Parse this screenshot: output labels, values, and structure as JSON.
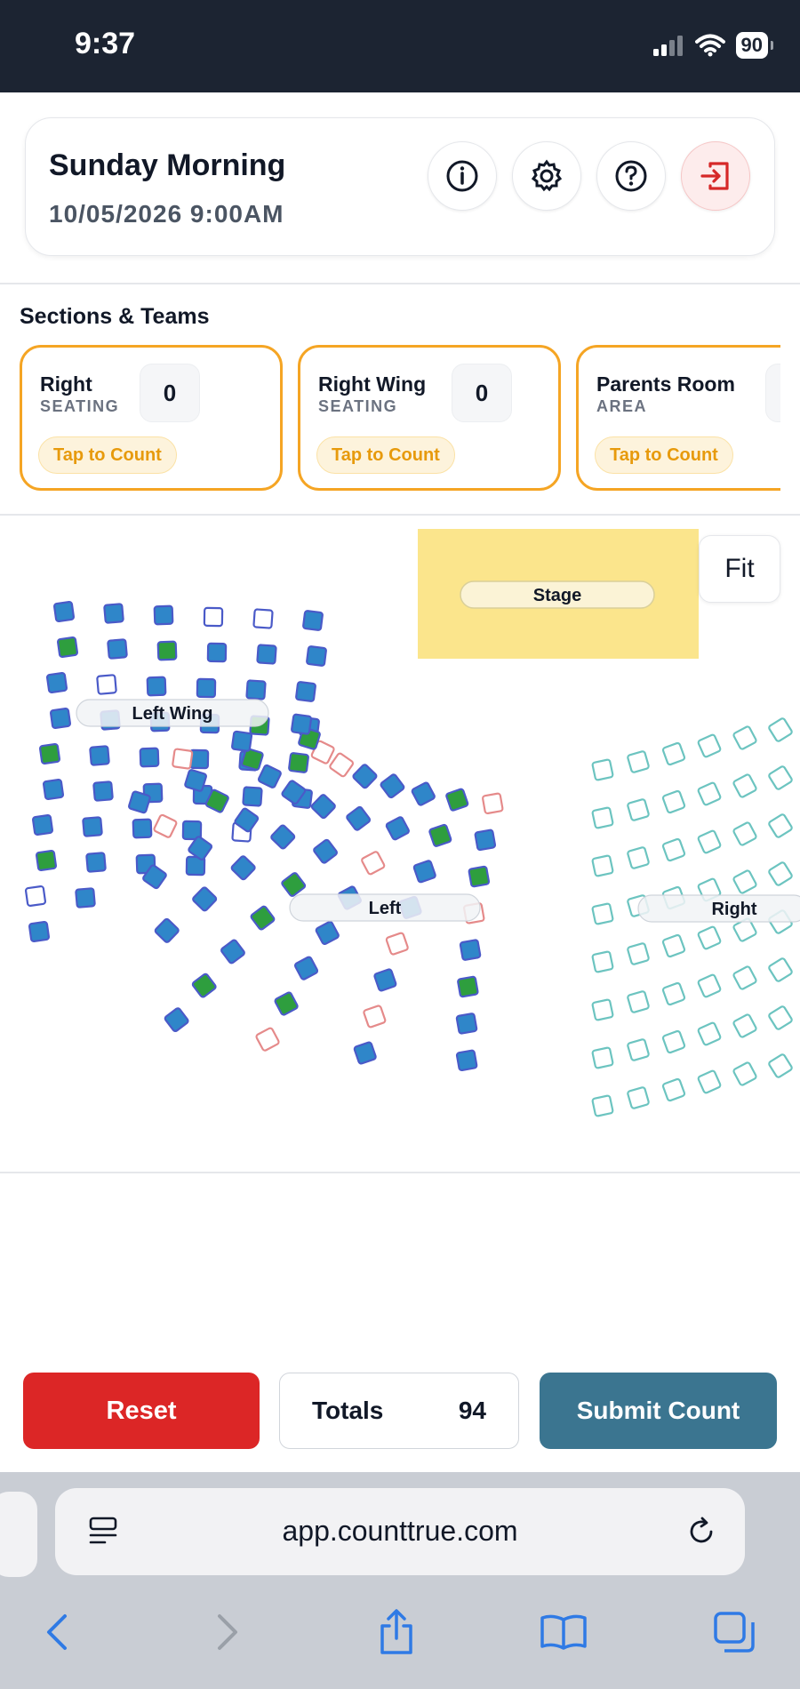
{
  "status_bar": {
    "time": "9:37",
    "battery": "90"
  },
  "header": {
    "title": "Sunday Morning",
    "datetime": "10/05/2026 9:00AM",
    "icons": [
      "info-icon",
      "gear-icon",
      "help-icon",
      "exit-icon"
    ]
  },
  "sections": {
    "heading": "Sections & Teams",
    "items": [
      {
        "name": "Right",
        "type": "SEATING",
        "count": "0",
        "action": "Tap to Count"
      },
      {
        "name": "Right Wing",
        "type": "SEATING",
        "count": "0",
        "action": "Tap to Count"
      },
      {
        "name": "Parents Room",
        "type": "AREA",
        "count": "",
        "action": "Tap to Count"
      }
    ]
  },
  "seat_map": {
    "fit_label": "Fit",
    "stage_label": "Stage",
    "section_labels": [
      "Left Wing",
      "Left",
      "Right"
    ],
    "colors": {
      "counted": "#2f86c9",
      "green": "#2e9e3e",
      "empty": "#ffffff",
      "stage": "#fbe58c"
    }
  },
  "footer": {
    "reset_label": "Reset",
    "totals_label": "Totals",
    "totals_value": "94",
    "submit_label": "Submit Count"
  },
  "browser": {
    "url": "app.counttrue.com"
  }
}
